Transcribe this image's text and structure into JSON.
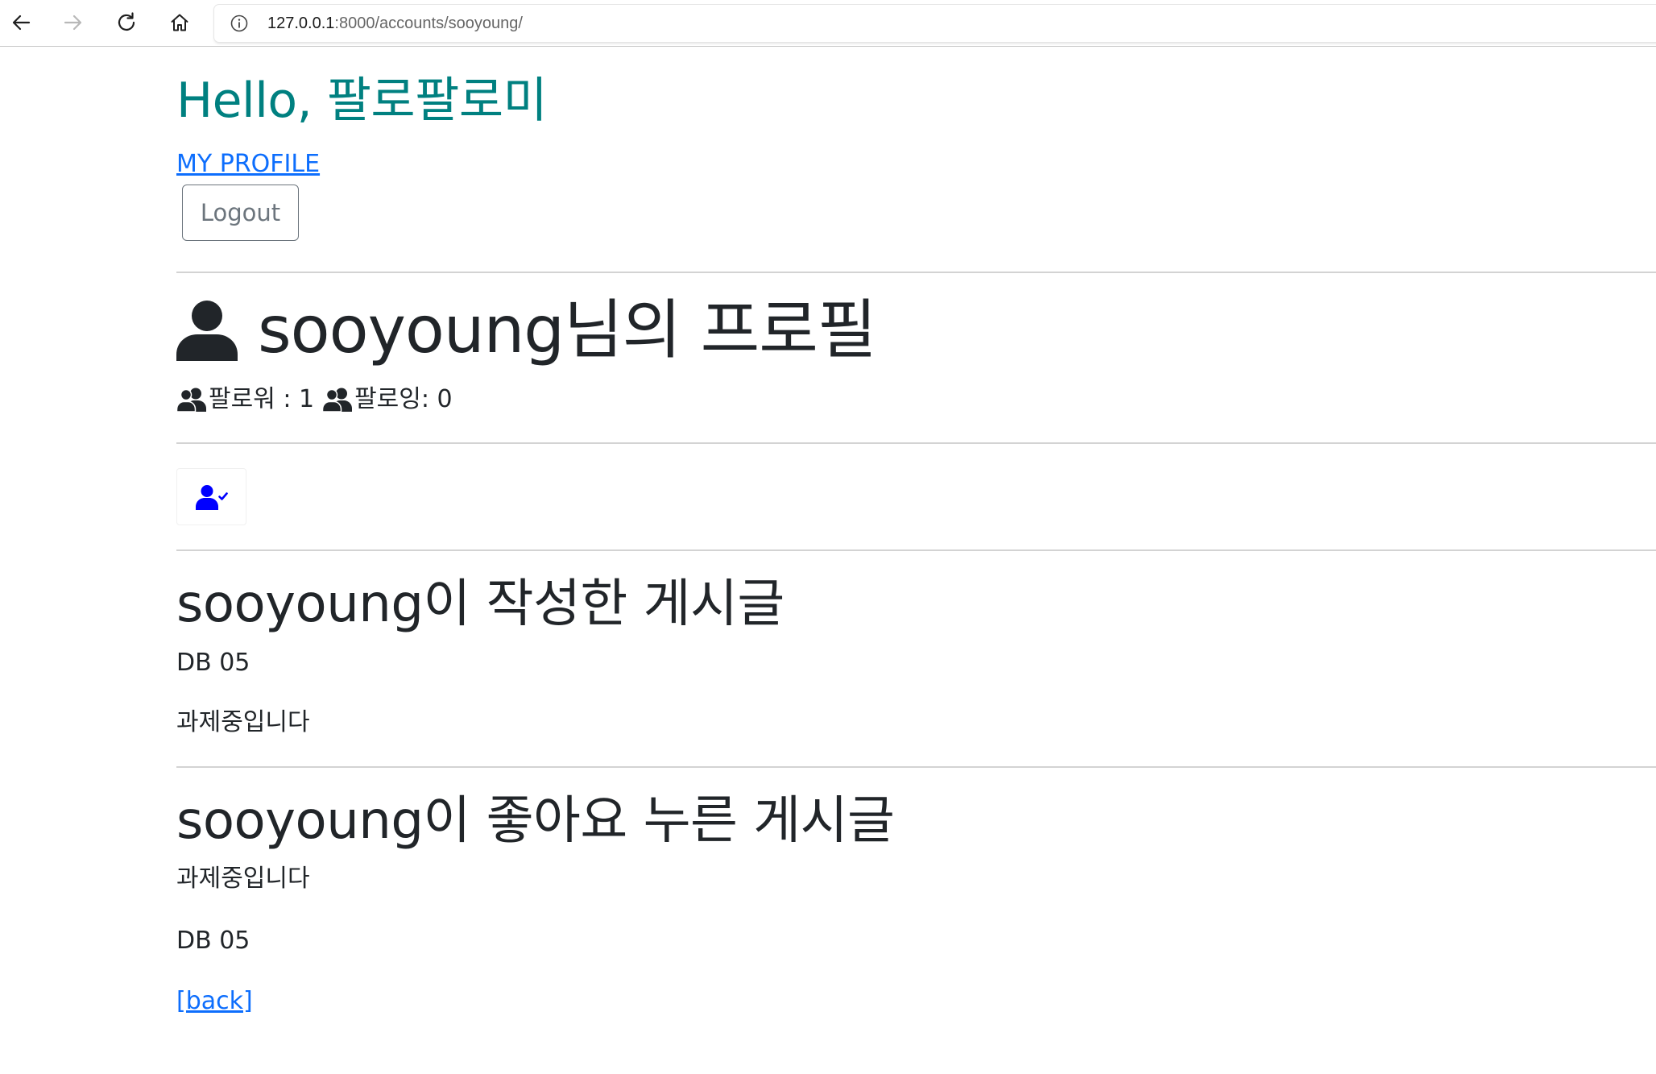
{
  "browser": {
    "url_host": "127.0.0.1",
    "url_rest": ":8000/accounts/sooyoung/",
    "icons": [
      "back-arrow-icon",
      "forward-arrow-icon",
      "reload-icon",
      "home-icon",
      "info-icon"
    ]
  },
  "header": {
    "greeting": "Hello, 팔로팔로미",
    "greeting_color": "#008080",
    "profile_link": "MY PROFILE",
    "logout_label": "Logout"
  },
  "profile": {
    "title": "sooyoung님의 프로필",
    "followers_label": "팔로워 : 1",
    "following_label": "팔로잉: 0",
    "follow_icon": "user-check-icon",
    "follow_icon_color": "#0000ff"
  },
  "written": {
    "title": "sooyoung이 작성한 게시글",
    "posts": [
      "DB 05",
      "과제중입니다"
    ]
  },
  "liked": {
    "title": "sooyoung이 좋아요 누른 게시글",
    "posts": [
      "과제중입니다",
      "DB 05"
    ]
  },
  "footer": {
    "back_link": "[back]"
  },
  "colors": {
    "link": "#0d6efd",
    "text": "#212529",
    "secondary": "#6c757d"
  }
}
